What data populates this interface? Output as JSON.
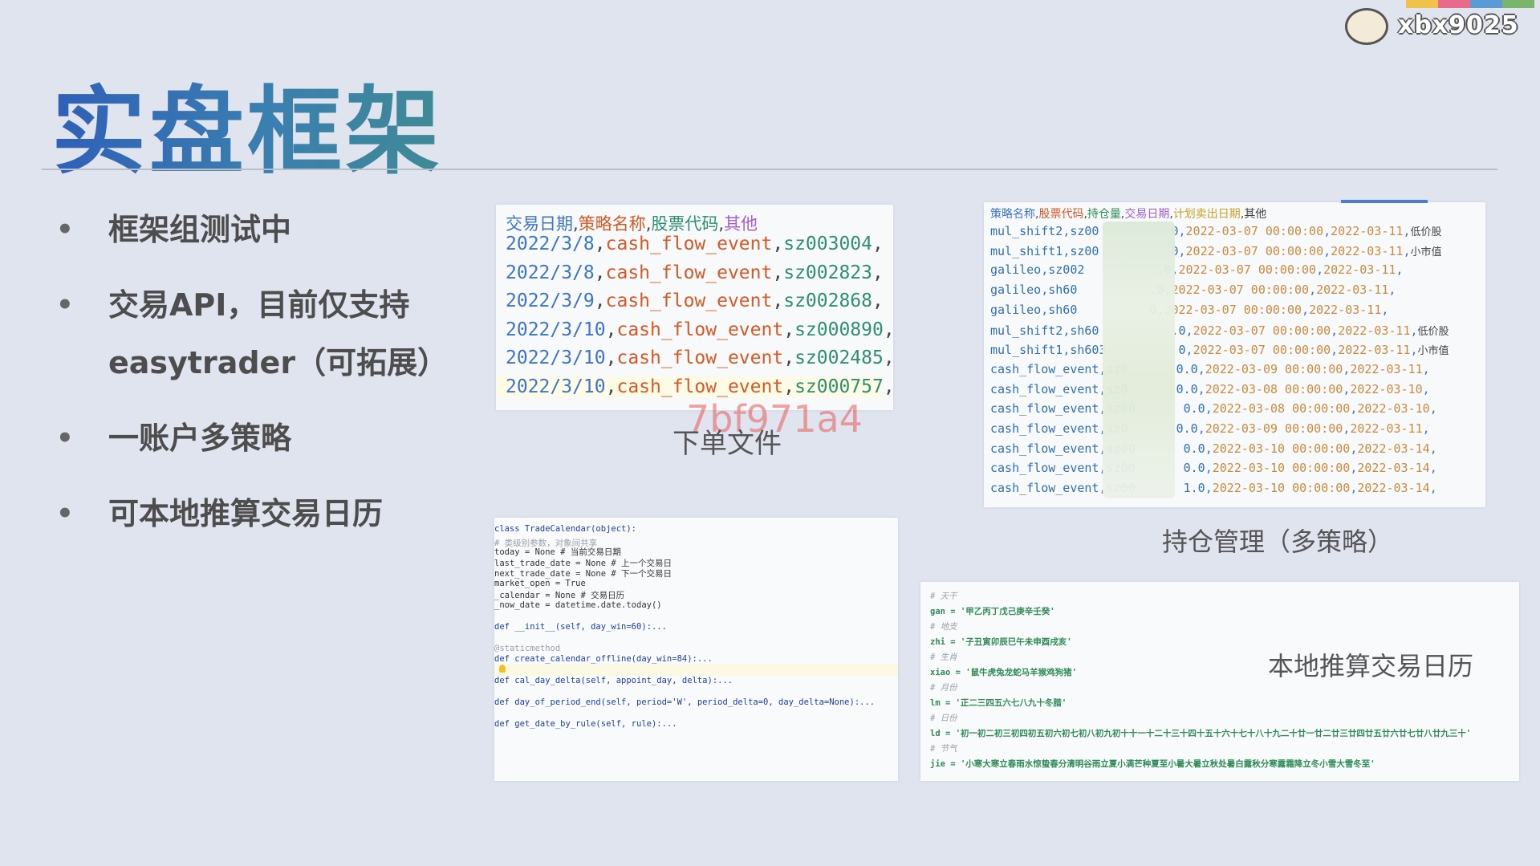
{
  "title": "实盘框架",
  "logo_text": "xbx9025",
  "bullets": [
    {
      "line1": "框架组测试中",
      "line2": ""
    },
    {
      "line1": "交易API，目前仅支持",
      "line2": "easytrader（可拓展）"
    },
    {
      "line1": "一账户多策略",
      "line2": ""
    },
    {
      "line1": "可本地推算交易日历",
      "line2": ""
    }
  ],
  "order_file": {
    "header": [
      "交易日期",
      "策略名称",
      "股票代码",
      "其他"
    ],
    "rows": [
      {
        "date": "2022/3/8",
        "strategy": "cash_flow_event",
        "code": "sz003004"
      },
      {
        "date": "2022/3/8",
        "strategy": "cash_flow_event",
        "code": "sz002823"
      },
      {
        "date": "2022/3/9",
        "strategy": "cash_flow_event",
        "code": "sz002868"
      },
      {
        "date": "2022/3/10",
        "strategy": "cash_flow_event",
        "code": "sz000890"
      },
      {
        "date": "2022/3/10",
        "strategy": "cash_flow_event",
        "code": "sz002485"
      },
      {
        "date": "2022/3/10",
        "strategy": "cash_flow_event",
        "code": "sz000757"
      }
    ],
    "caption": "下单文件",
    "watermark": "7bf971a4"
  },
  "position_file": {
    "header": [
      "策略名称",
      "股票代码",
      "持仓量",
      "交易日期",
      "计划卖出日期",
      "其他"
    ],
    "rows": [
      {
        "name": "mul_shift2",
        "code": "sz00",
        "qty": "0",
        "trade": "2022-03-07 00:00:00",
        "sell": "2022-03-11",
        "note": "低价股"
      },
      {
        "name": "mul_shift1",
        "code": "sz00",
        "qty": "0",
        "trade": "2022-03-07 00:00:00",
        "sell": "2022-03-11",
        "note": "小市值"
      },
      {
        "name": "galileo",
        "code": "sz002",
        "qty": ".0",
        "trade": "2022-03-07 00:00:00",
        "sell": "2022-03-11",
        "note": ""
      },
      {
        "name": "galileo",
        "code": "sh60",
        "qty": ".0",
        "trade": "2022-03-07 00:00:00",
        "sell": "2022-03-11",
        "note": ""
      },
      {
        "name": "galileo",
        "code": "sh60",
        "qty": "0",
        "trade": "2022-03-07 00:00:00",
        "sell": "2022-03-11",
        "note": ""
      },
      {
        "name": "mul_shift2",
        "code": "sh60",
        "qty": ".0",
        "trade": "2022-03-07 00:00:00",
        "sell": "2022-03-11",
        "note": "低价股"
      },
      {
        "name": "mul_shift1",
        "code": "sh603",
        "qty": "0",
        "trade": "2022-03-07 00:00:00",
        "sell": "2022-03-11",
        "note": "小市值"
      },
      {
        "name": "cash_flow_event",
        "code": "sz0",
        "qty": "0.0",
        "trade": "2022-03-09 00:00:00",
        "sell": "2022-03-11",
        "note": ""
      },
      {
        "name": "cash_flow_event",
        "code": "sz0",
        "qty": "0.0",
        "trade": "2022-03-08 00:00:00",
        "sell": "2022-03-10",
        "note": ""
      },
      {
        "name": "cash_flow_event",
        "code": "sz00",
        "qty": "0.0",
        "trade": "2022-03-08 00:00:00",
        "sell": "2022-03-10",
        "note": ""
      },
      {
        "name": "cash_flow_event",
        "code": "sz0",
        "qty": "0.0",
        "trade": "2022-03-09 00:00:00",
        "sell": "2022-03-11",
        "note": ""
      },
      {
        "name": "cash_flow_event",
        "code": "sz00",
        "qty": "0.0",
        "trade": "2022-03-10 00:00:00",
        "sell": "2022-03-14",
        "note": ""
      },
      {
        "name": "cash_flow_event",
        "code": "sz00",
        "qty": "0.0",
        "trade": "2022-03-10 00:00:00",
        "sell": "2022-03-14",
        "note": ""
      },
      {
        "name": "cash_flow_event",
        "code": "sz00",
        "qty": "1.0",
        "trade": "2022-03-10 00:00:00",
        "sell": "2022-03-14",
        "note": ""
      }
    ],
    "caption": "持仓管理（多策略）"
  },
  "code": {
    "lines": [
      "class TradeCalendar(object):",
      "    # 类级别参数，对象间共享",
      "    today = None  # 当前交易日期",
      "    last_trade_date = None  # 上一个交易日",
      "    next_trade_date = None  # 下一个交易日",
      "    market_open = True",
      "    _calendar = None  # 交易日历",
      "    _now_date = datetime.date.today()",
      "",
      "    def __init__(self, day_win=60):...",
      "",
      "    @staticmethod",
      "    def create_calendar_offline(day_win=84):...",
      "",
      "    def cal_day_delta(self, appoint_day, delta):...",
      "",
      "    def day_of_period_end(self, period='W', period_delta=0, day_delta=None):...",
      "",
      "    def get_date_by_rule(self, rule):..."
    ]
  },
  "calendar": {
    "lines": [
      {
        "type": "comment",
        "text": "# 天干"
      },
      {
        "type": "assign",
        "text": "gan = '甲乙丙丁戊己庚辛壬癸'"
      },
      {
        "type": "comment",
        "text": "# 地支"
      },
      {
        "type": "assign",
        "text": "zhi = '子丑寅卯辰巳午未申酉戌亥'"
      },
      {
        "type": "comment",
        "text": "# 生肖"
      },
      {
        "type": "assign",
        "text": "xiao = '鼠牛虎兔龙蛇马羊猴鸡狗猪'"
      },
      {
        "type": "comment",
        "text": "# 月份"
      },
      {
        "type": "assign",
        "text": "lm = '正二三四五六七八九十冬腊'"
      },
      {
        "type": "comment",
        "text": "# 日份"
      },
      {
        "type": "assign",
        "text": "ld = '初一初二初三初四初五初六初七初八初九初十十一十二十三十四十五十六十七十八十九二十廿一廿二廿三廿四廿五廿六廿七廿八廿九三十'"
      },
      {
        "type": "comment",
        "text": "# 节气"
      },
      {
        "type": "assign",
        "text": "jie = '小寒大寒立春雨水惊蛰春分清明谷雨立夏小满芒种夏至小暑大暑立秋处暑白露秋分寒露霜降立冬小雪大雪冬至'"
      }
    ],
    "caption": "本地推算交易日历"
  }
}
